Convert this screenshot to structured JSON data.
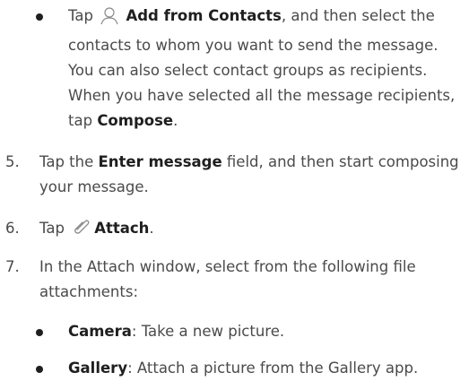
{
  "bullet1": {
    "pre": "Tap ",
    "bold": "Add from Contacts",
    "post": ", and then select the contacts to whom you want to send the message. You can also select contact groups as recipients. When you have selected all the message recipients, tap ",
    "bold2": "Compose",
    "end": ".",
    "icon": "person-icon"
  },
  "step5": {
    "num": "5.",
    "pre": "Tap the ",
    "bold": "Enter message",
    "post": " field, and then start composing your message."
  },
  "step6": {
    "num": "6.",
    "pre": "Tap ",
    "bold": "Attach",
    "end": ".",
    "icon": "paperclip-icon"
  },
  "step7": {
    "num": "7.",
    "text": "In the Attach window, select from the following file attachments:"
  },
  "sub": [
    {
      "bold": "Camera",
      "text": ": Take a new picture."
    },
    {
      "bold": "Gallery",
      "text": ": Attach a picture from the Gallery app."
    }
  ]
}
